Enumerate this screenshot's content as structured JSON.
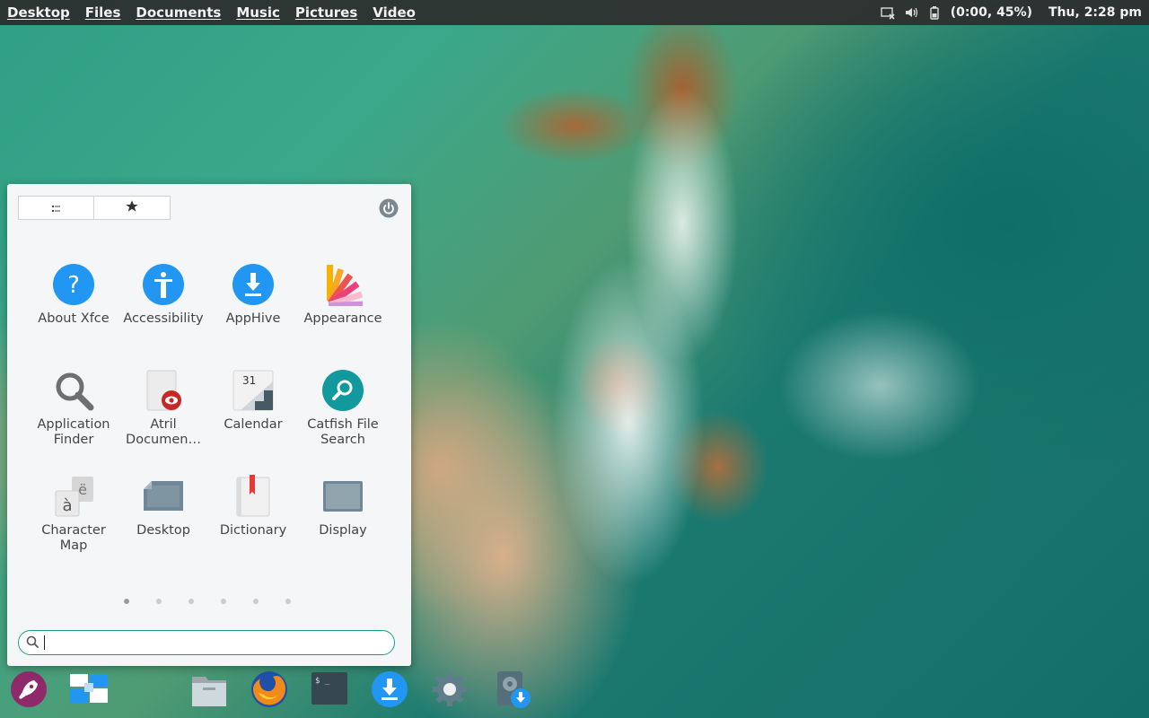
{
  "top_panel": {
    "places": [
      "Desktop",
      "Files",
      "Documents",
      "Music",
      "Pictures",
      "Video"
    ],
    "battery_text": "(0:00, 45%)",
    "clock": "Thu,  2:28 pm"
  },
  "menu": {
    "apps": [
      {
        "label": "About Xfce",
        "icon": "about-xfce-icon"
      },
      {
        "label": "Accessibility",
        "icon": "accessibility-icon"
      },
      {
        "label": "AppHive",
        "icon": "apphive-icon"
      },
      {
        "label": "Appearance",
        "icon": "appearance-icon"
      },
      {
        "label": "Application Finder",
        "icon": "application-finder-icon"
      },
      {
        "label": "Atril Documen…",
        "icon": "atril-icon"
      },
      {
        "label": "Calendar",
        "icon": "calendar-icon"
      },
      {
        "label": "Catfish File Search",
        "icon": "catfish-icon"
      },
      {
        "label": "Character Map",
        "icon": "character-map-icon"
      },
      {
        "label": "Desktop",
        "icon": "desktop-icon"
      },
      {
        "label": "Dictionary",
        "icon": "dictionary-icon"
      },
      {
        "label": "Display",
        "icon": "display-icon"
      }
    ],
    "calendar_day": "31",
    "charmap_chars": [
      "à",
      "ë"
    ],
    "pages": 6,
    "active_page": 1,
    "search": {
      "value": "",
      "placeholder": ""
    }
  },
  "dock": [
    "launcher-icon",
    "workspaces-icon",
    "file-manager-icon",
    "firefox-icon",
    "terminal-icon",
    "apphive-download-icon",
    "settings-icon",
    "installer-icon"
  ],
  "colors": {
    "accent": "#16a085",
    "blue": "#2196f3",
    "teal": "#11999e",
    "panel": "#2d2d2d"
  }
}
